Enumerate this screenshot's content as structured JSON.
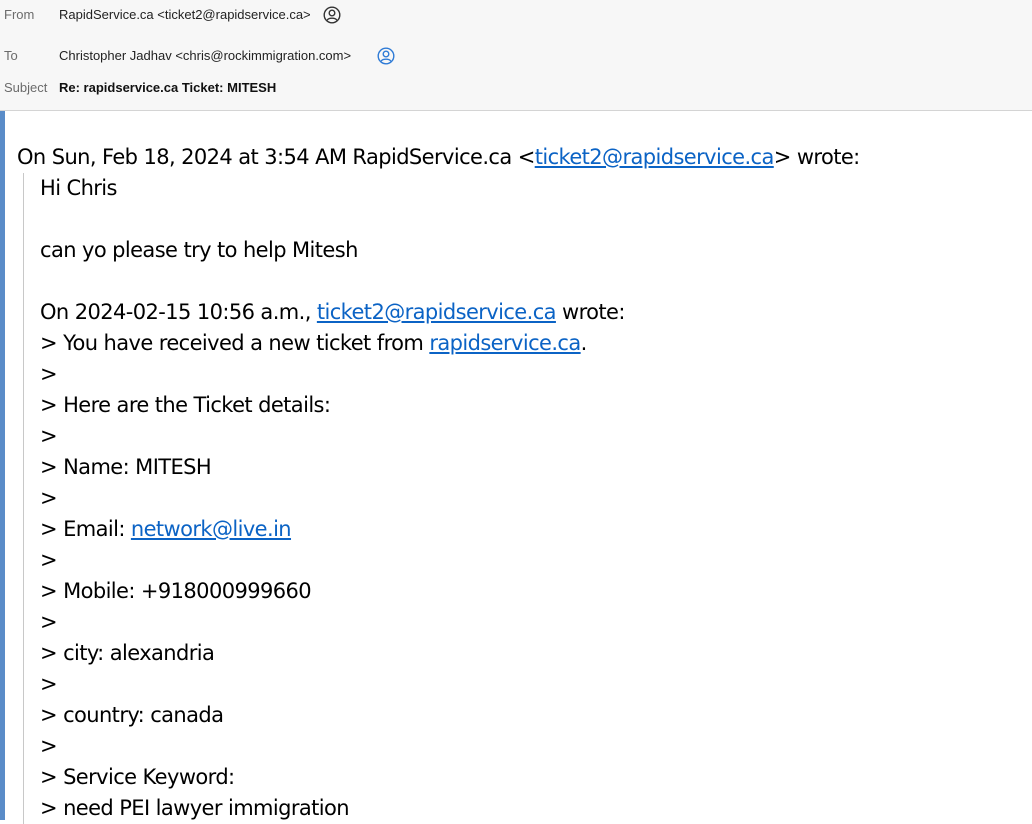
{
  "header": {
    "from_label": "From",
    "from_value": "RapidService.ca <ticket2@rapidservice.ca>",
    "to_label": "To",
    "to_value": "Christopher Jadhav <chris@rockimmigration.com>",
    "subject_label": "Subject",
    "subject_value": "Re: rapidservice.ca Ticket: MITESH"
  },
  "body": {
    "intro_pre": "On Sun, Feb 18, 2024 at 3:54 AM RapidService.ca <",
    "intro_link": "ticket2@rapidservice.ca",
    "intro_post": "> wrote:",
    "greeting": "Hi Chris",
    "request": "can yo please try to help Mitesh",
    "quote_pre": "On 2024-02-15 10:56 a.m., ",
    "quote_link": "ticket2@rapidservice.ca",
    "quote_post": " wrote:",
    "received_pre": "> You have received a new ticket from ",
    "received_link": "rapidservice.ca",
    "received_post": ".",
    "gt": ">",
    "details": "> Here are the Ticket details:",
    "name": "> Name: MITESH",
    "email_pre": "> Email: ",
    "email_link": "network@live.in",
    "mobile": "> Mobile: +918000999660",
    "city": "> city: alexandria",
    "country": "> country: canada",
    "keyword": "> Service Keyword:",
    "keyword_value": "> need PEI lawyer immigration"
  },
  "colors": {
    "link": "#0b63c5",
    "accent_bar": "#5a8cc8",
    "header_bg": "#f7f7f7"
  }
}
